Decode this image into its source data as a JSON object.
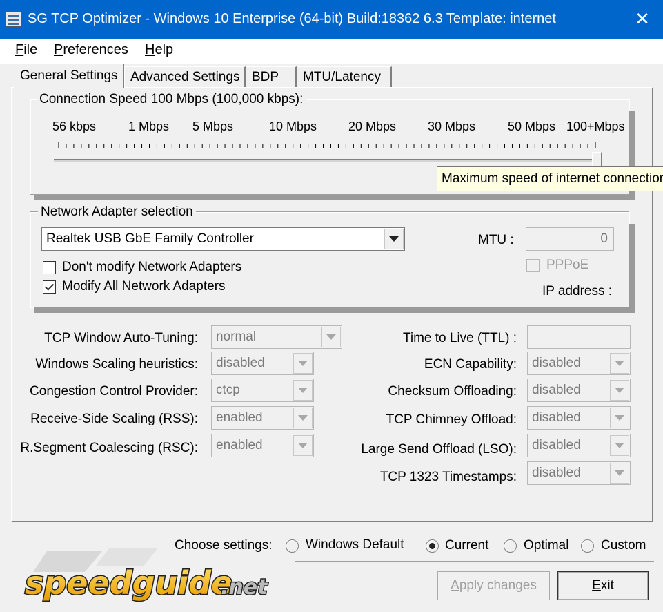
{
  "window": {
    "title": "SG TCP Optimizer - Windows 10 Enterprise (64-bit) Build:18362 6.3  Template: internet",
    "close_glyph": "✕"
  },
  "menu": {
    "items": [
      {
        "label": "File",
        "accel": "F",
        "rest": "ile"
      },
      {
        "label": "Preferences",
        "accel": "P",
        "rest": "references"
      },
      {
        "label": "Help",
        "accel": "H",
        "rest": "elp"
      }
    ]
  },
  "tabs": [
    {
      "label": "General Settings",
      "active": true
    },
    {
      "label": "Advanced Settings",
      "active": false
    },
    {
      "label": "BDP",
      "active": false
    },
    {
      "label": "MTU/Latency",
      "active": false
    }
  ],
  "connection_speed": {
    "group_label": "Connection Speed  100 Mbps (100,000 kbps):",
    "ticks": [
      "56 kbps",
      "1 Mbps",
      "5 Mbps",
      "10 Mbps",
      "20 Mbps",
      "30 Mbps",
      "50 Mbps",
      "100+Mbps"
    ],
    "value_fraction": 1.0,
    "tooltip": "Maximum speed of internet connection"
  },
  "adapter": {
    "group_label": "Network Adapter selection",
    "selected": "Realtek USB GbE Family Controller",
    "mtu_label": "MTU :",
    "mtu_value": "0",
    "pppoe_label": "PPPoE",
    "pppoe_checked": false,
    "ip_label": "IP address :",
    "dont_modify_label": "Don't modify Network Adapters",
    "dont_modify_checked": false,
    "modify_all_label": "Modify All Network Adapters",
    "modify_all_checked": true
  },
  "settings_left": [
    {
      "label": "TCP Window Auto-Tuning:",
      "value": "normal"
    },
    {
      "label": "Windows Scaling heuristics:",
      "value": "disabled"
    },
    {
      "label": "Congestion Control Provider:",
      "value": "ctcp"
    },
    {
      "label": "Receive-Side Scaling (RSS):",
      "value": "enabled"
    },
    {
      "label": "R.Segment Coalescing (RSC):",
      "value": "enabled"
    }
  ],
  "settings_right": {
    "ttl_label": "Time to Live (TTL) :",
    "ttl_value": "",
    "items": [
      {
        "label": "ECN Capability:",
        "value": "disabled"
      },
      {
        "label": "Checksum Offloading:",
        "value": "disabled"
      },
      {
        "label": "TCP Chimney Offload:",
        "value": "disabled"
      },
      {
        "label": "Large Send Offload (LSO):",
        "value": "disabled"
      },
      {
        "label": "TCP 1323 Timestamps:",
        "value": "disabled"
      }
    ]
  },
  "choose_settings": {
    "label": "Choose settings:",
    "options": [
      {
        "label": "Windows Default",
        "selected": false
      },
      {
        "label": "Current",
        "selected": true
      },
      {
        "label": "Optimal",
        "selected": false
      },
      {
        "label": "Custom",
        "selected": false
      }
    ]
  },
  "buttons": {
    "apply": {
      "label": "Apply changes",
      "accel": "A",
      "rest": "pply changes"
    },
    "exit": {
      "label": "Exit",
      "accel": "E",
      "rest": "xit"
    }
  },
  "logo": {
    "text": "speedguide",
    "suffix": ".net"
  },
  "colors": {
    "titlebar": "#0066cc",
    "tooltip_bg": "#ffffe1",
    "logo_fill": "#f5b800"
  }
}
